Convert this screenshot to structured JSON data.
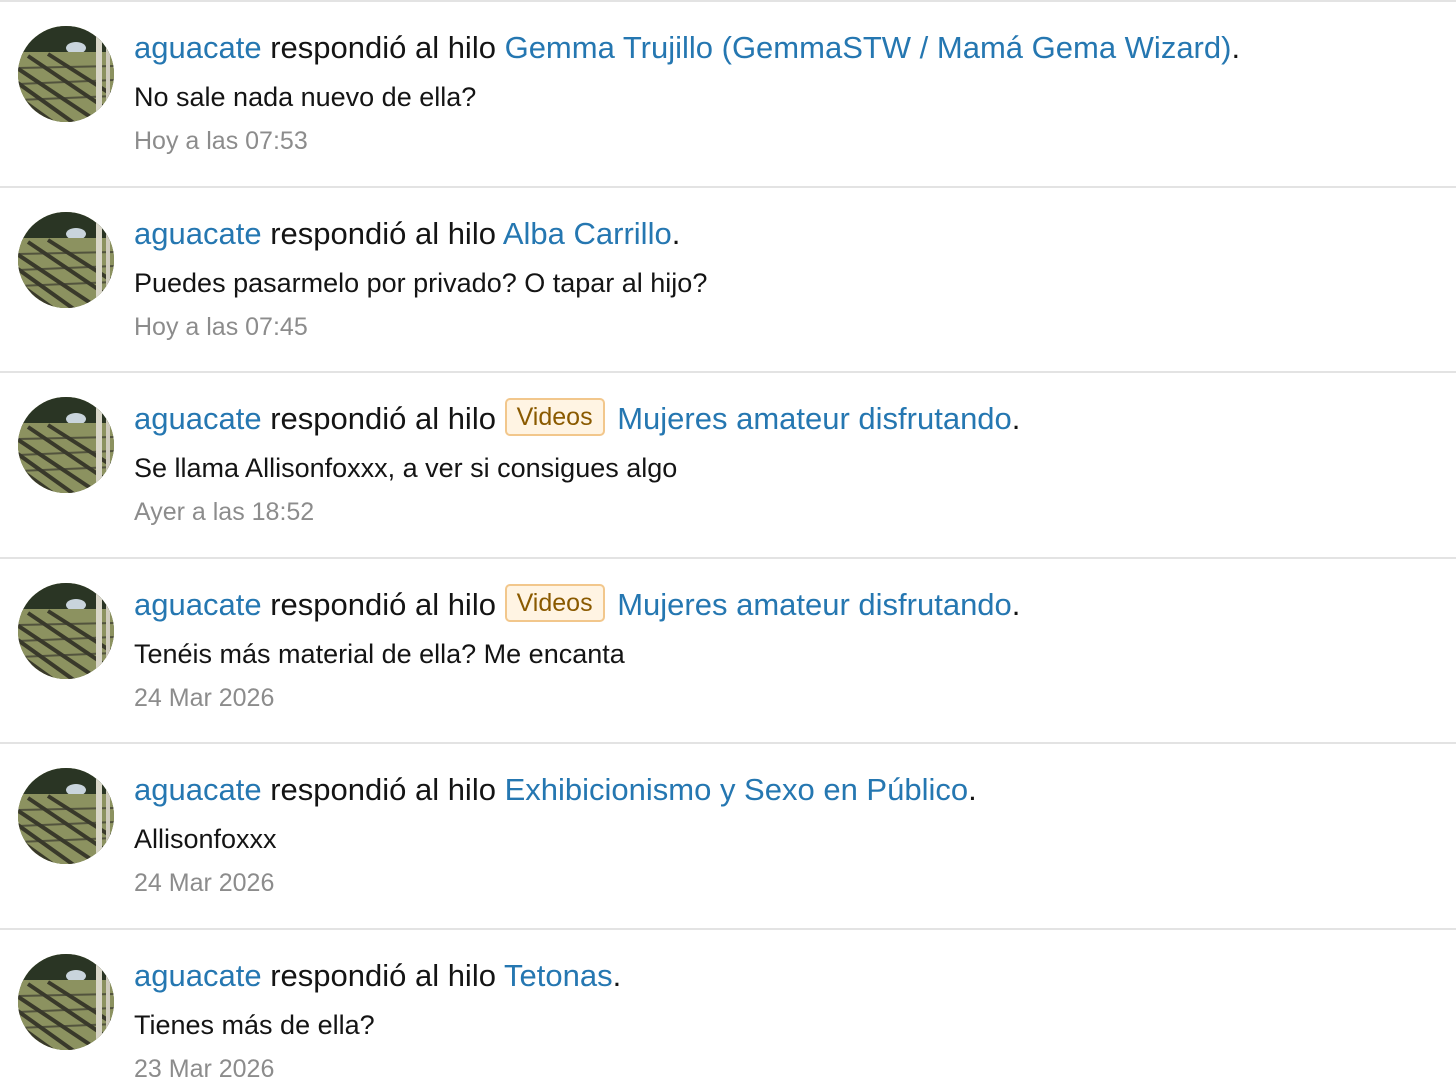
{
  "feed": {
    "items": [
      {
        "user": "aguacate",
        "action": "respondió al hilo",
        "prefix": "",
        "thread": "Gemma Trujillo (GemmaSTW / Mamá Gema Wizard)",
        "snippet": "No sale nada nuevo de ella?",
        "time": "Hoy a las 07:53"
      },
      {
        "user": "aguacate",
        "action": "respondió al hilo",
        "prefix": "",
        "thread": "Alba Carrillo",
        "snippet": "Puedes pasarmelo por privado? O tapar al hijo?",
        "time": "Hoy a las 07:45"
      },
      {
        "user": "aguacate",
        "action": "respondió al hilo",
        "prefix": "Videos",
        "thread": "Mujeres amateur disfrutando",
        "snippet": "Se llama Allisonfoxxx, a ver si consigues algo",
        "time": "Ayer a las 18:52"
      },
      {
        "user": "aguacate",
        "action": "respondió al hilo",
        "prefix": "Videos",
        "thread": "Mujeres amateur disfrutando",
        "snippet": "Tenéis más material de ella? Me encanta",
        "time": "24 Mar 2026"
      },
      {
        "user": "aguacate",
        "action": "respondió al hilo",
        "prefix": "",
        "thread": "Exhibicionismo y Sexo en Público",
        "snippet": "Allisonfoxxx",
        "time": "24 Mar 2026"
      },
      {
        "user": "aguacate",
        "action": "respondió al hilo",
        "prefix": "",
        "thread": "Tetonas",
        "snippet": "Tienes más de ella?",
        "time": "23 Mar 2026"
      }
    ]
  },
  "colors": {
    "link": "#2577b1",
    "text": "#141414",
    "muted": "#8c8c8c",
    "divider": "#e3e3e3",
    "prefix_bg": "#fff4e3",
    "prefix_border": "#f2c78c",
    "prefix_text": "#8a5a00"
  }
}
